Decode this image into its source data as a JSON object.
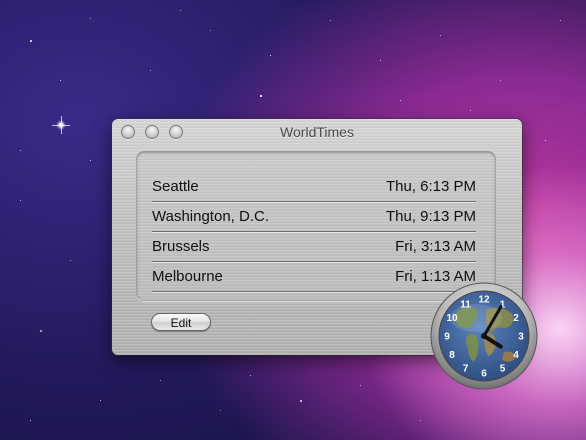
{
  "window": {
    "title": "WorldTimes"
  },
  "cities": [
    {
      "name": "Seattle",
      "time": "Thu, 6:13 PM"
    },
    {
      "name": "Washington, D.C.",
      "time": "Thu, 9:13 PM"
    },
    {
      "name": "Brussels",
      "time": "Fri, 3:13 AM"
    },
    {
      "name": "Melbourne",
      "time": "Fri, 1:13 AM"
    }
  ],
  "buttons": {
    "edit": "Edit"
  },
  "clock": {
    "numerals": [
      "12",
      "1",
      "2",
      "3",
      "4",
      "5",
      "6",
      "7",
      "8",
      "9",
      "10",
      "11"
    ],
    "hour": 4,
    "minute": 5
  },
  "colors": {
    "desktop_purple": "#8a2a92",
    "desktop_blue": "#241a5e",
    "clock_ocean": "#3a5f96"
  }
}
